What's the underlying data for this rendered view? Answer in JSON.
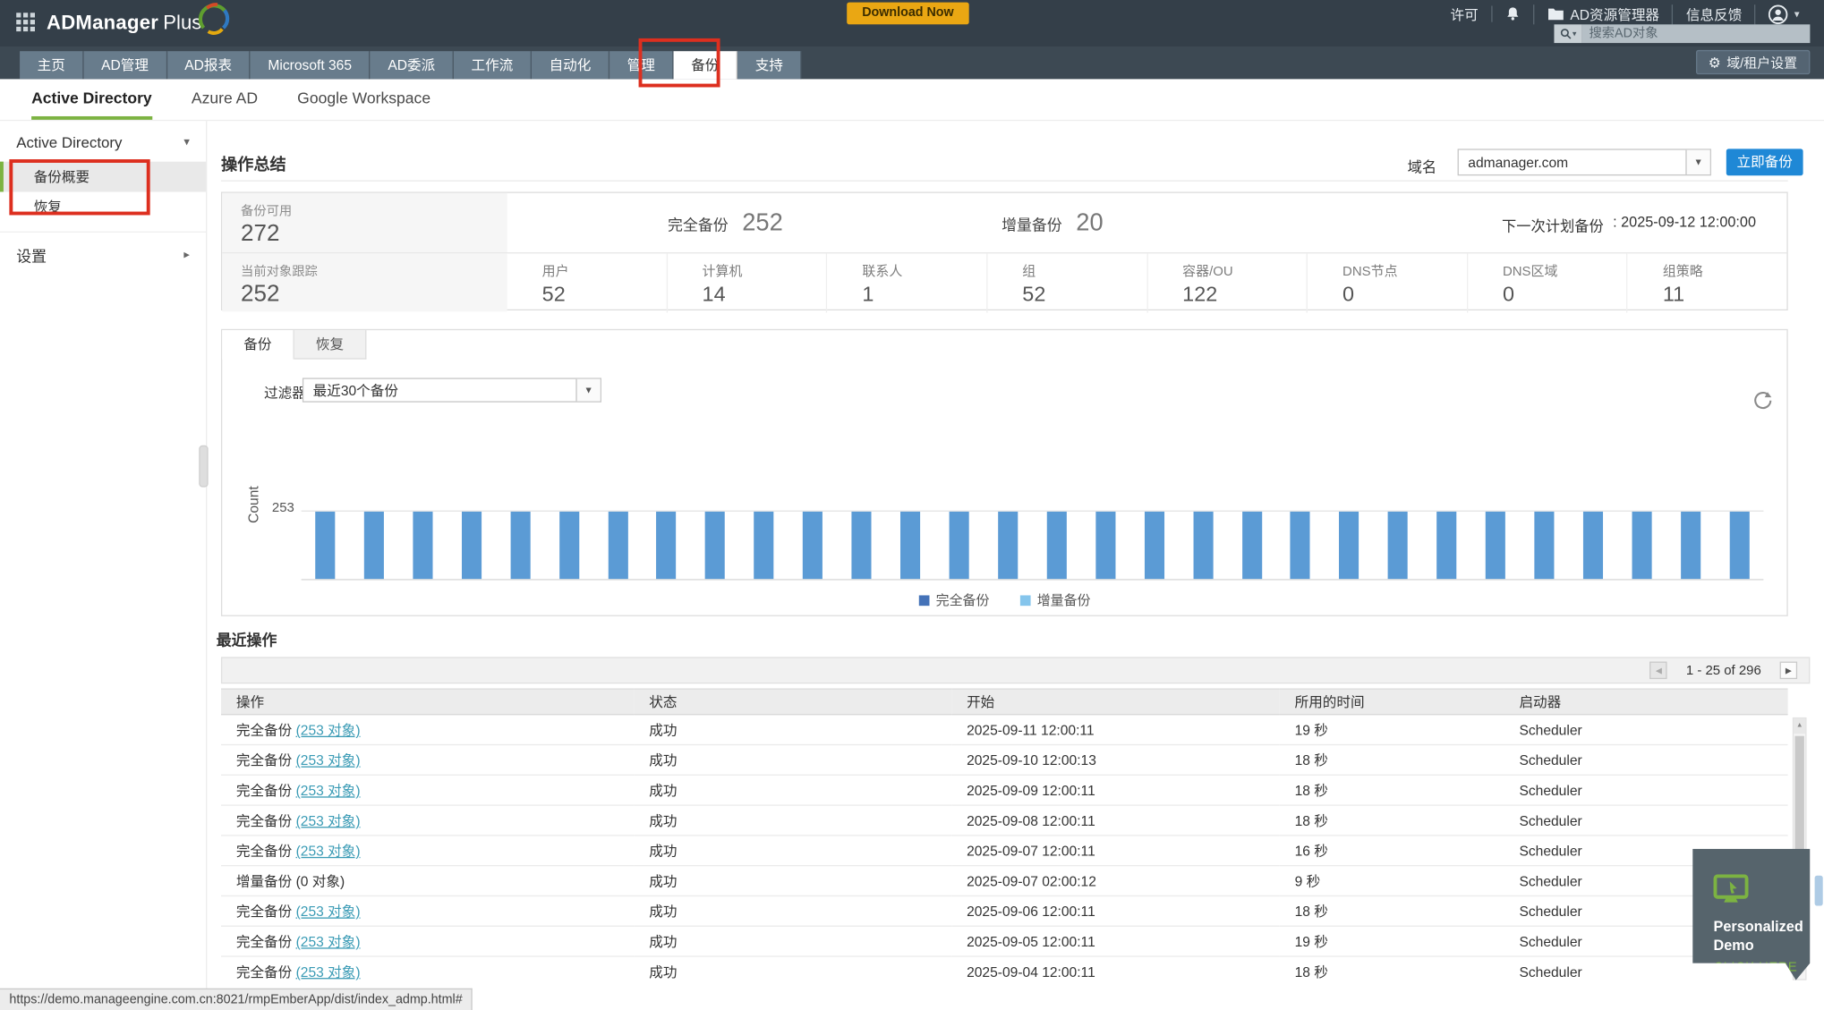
{
  "colors": {
    "header_bg": "#343f49",
    "tabband_bg": "#3d4953",
    "tab_bg": "#687c8c",
    "accent_green": "#7cb342",
    "primary_blue": "#1f88d6",
    "bar_blue": "#5b9bd5",
    "legend_full": "#4472b8",
    "legend_incr": "#85c5ec",
    "annotation_red": "#dd2f1f",
    "link_teal": "#3a9bb5",
    "download_yellow": "#eaa713",
    "demo_bg": "#56646c"
  },
  "icons": {
    "caret_down": "▾",
    "caret_right": "▸",
    "select_caret": "▼",
    "left_arrow": "◀",
    "right_arrow": "▶",
    "up_arrow": "▲",
    "gear": "⚙"
  },
  "header": {
    "logo_primary": "ADManager",
    "logo_secondary": "Plus",
    "download_label": "Download Now",
    "license_label": "许可",
    "resource_manager_label": "AD资源管理器",
    "feedback_label": "信息反馈",
    "search_placeholder": "搜索AD对象",
    "domain_settings_label": "域/租户设置"
  },
  "nav_tabs": [
    {
      "label": "主页",
      "active": false
    },
    {
      "label": "AD管理",
      "active": false
    },
    {
      "label": "AD报表",
      "active": false
    },
    {
      "label": "Microsoft 365",
      "active": false
    },
    {
      "label": "AD委派",
      "active": false
    },
    {
      "label": "工作流",
      "active": false
    },
    {
      "label": "自动化",
      "active": false
    },
    {
      "label": "管理",
      "active": false
    },
    {
      "label": "备份",
      "active": true
    },
    {
      "label": "支持",
      "active": false
    }
  ],
  "subnav_tabs": [
    {
      "label": "Active Directory",
      "active": true
    },
    {
      "label": "Azure AD",
      "active": false
    },
    {
      "label": "Google Workspace",
      "active": false
    }
  ],
  "sidebar": {
    "group_label": "Active Directory",
    "items": [
      {
        "label": "备份概要",
        "selected": true
      },
      {
        "label": "恢复",
        "selected": false
      }
    ],
    "settings_label": "设置"
  },
  "summary": {
    "title": "操作总结",
    "domain_label": "域名",
    "domain_value": "admanager.com",
    "backup_now_label": "立即备份",
    "backups_available_label": "备份可用",
    "backups_available_value": "272",
    "full_backup_label": "完全备份",
    "full_backup_value": "252",
    "incremental_label": "增量备份",
    "incremental_value": "20",
    "next_scheduled_label": "下一次计划备份",
    "next_scheduled_value": ": 2025-09-12 12:00:00",
    "objects_tracked_label": "当前对象跟踪",
    "objects_tracked_value": "252",
    "object_counts": [
      {
        "label": "用户",
        "value": "52"
      },
      {
        "label": "计算机",
        "value": "14"
      },
      {
        "label": "联系人",
        "value": "1"
      },
      {
        "label": "组",
        "value": "52"
      },
      {
        "label": "容器/OU",
        "value": "122"
      },
      {
        "label": "DNS节点",
        "value": "0"
      },
      {
        "label": "DNS区域",
        "value": "0"
      },
      {
        "label": "组策略",
        "value": "11"
      }
    ]
  },
  "chart_card": {
    "tabs": [
      {
        "label": "备份",
        "active": true
      },
      {
        "label": "恢复",
        "active": false
      }
    ],
    "filter_label": "过滤器",
    "filter_value": "最近30个备份"
  },
  "chart_data": {
    "type": "bar",
    "title": "",
    "xlabel": "",
    "ylabel": "Count",
    "ytick_labels": [
      "253"
    ],
    "ylim": [
      0,
      253
    ],
    "grid": "top-gridline-and-baseline",
    "legend_position": "bottom",
    "series": [
      {
        "name": "完全备份",
        "color": "#4472b8",
        "bar_color": "#5b9bd5",
        "values": [
          253,
          253,
          253,
          253,
          253,
          253,
          253,
          253,
          253,
          253,
          253,
          253,
          253,
          253,
          253,
          253,
          253,
          253,
          253,
          253,
          253,
          253,
          253,
          253,
          253,
          253,
          253,
          253,
          253,
          253
        ]
      },
      {
        "name": "增量备份",
        "color": "#85c5ec",
        "bar_color": "#85c5ec",
        "values": []
      }
    ]
  },
  "recent": {
    "title": "最近操作",
    "pagination": "1 - 25 of 296",
    "columns": [
      "操作",
      "状态",
      "开始",
      "所用的时间",
      "启动器"
    ],
    "rows": [
      {
        "op": "完全备份",
        "objects": "(253 对象)",
        "status": "成功",
        "start": "2025-09-11 12:00:11",
        "duration": "19 秒",
        "initiator": "Scheduler"
      },
      {
        "op": "完全备份",
        "objects": "(253 对象)",
        "status": "成功",
        "start": "2025-09-10 12:00:13",
        "duration": "18 秒",
        "initiator": "Scheduler"
      },
      {
        "op": "完全备份",
        "objects": "(253 对象)",
        "status": "成功",
        "start": "2025-09-09 12:00:11",
        "duration": "18 秒",
        "initiator": "Scheduler"
      },
      {
        "op": "完全备份",
        "objects": "(253 对象)",
        "status": "成功",
        "start": "2025-09-08 12:00:11",
        "duration": "18 秒",
        "initiator": "Scheduler"
      },
      {
        "op": "完全备份",
        "objects": "(253 对象)",
        "status": "成功",
        "start": "2025-09-07 12:00:11",
        "duration": "16 秒",
        "initiator": "Scheduler"
      },
      {
        "op": "增量备份 (0 对象)",
        "objects": "",
        "status": "成功",
        "start": "2025-09-07 02:00:12",
        "duration": "9 秒",
        "initiator": "Scheduler"
      },
      {
        "op": "完全备份",
        "objects": "(253 对象)",
        "status": "成功",
        "start": "2025-09-06 12:00:11",
        "duration": "18 秒",
        "initiator": "Scheduler"
      },
      {
        "op": "完全备份",
        "objects": "(253 对象)",
        "status": "成功",
        "start": "2025-09-05 12:00:11",
        "duration": "19 秒",
        "initiator": "Scheduler"
      },
      {
        "op": "完全备份",
        "objects": "(253 对象)",
        "status": "成功",
        "start": "2025-09-04 12:00:11",
        "duration": "18 秒",
        "initiator": "Scheduler"
      }
    ]
  },
  "demo_widget": {
    "line1": "Personalized",
    "line2": "Demo",
    "cta": "CLICK HERE"
  },
  "status_bar": {
    "url": "https://demo.manageengine.com.cn:8021/rmpEmberApp/dist/index_admp.html#"
  }
}
